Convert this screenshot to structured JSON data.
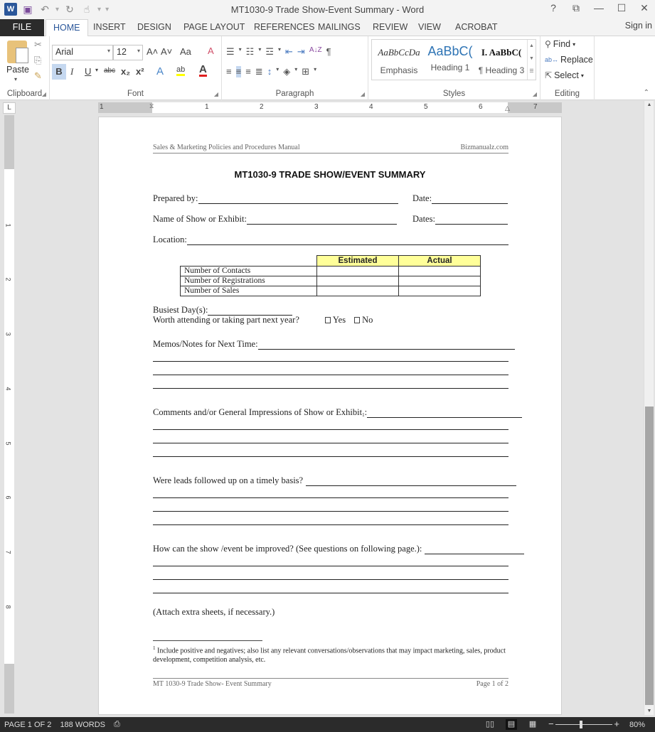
{
  "window": {
    "title": "MT1030-9 Trade Show-Event Summary - Word",
    "controls": {
      "help": "?",
      "ribbon_display": "⧉",
      "minimize": "—",
      "maximize": "☐",
      "close": "✕"
    }
  },
  "quick_access": {
    "app_icon": "W",
    "save_icon": "💾",
    "undo_icon": "↶",
    "redo_icon": "↻",
    "touch_icon": "☝",
    "customize_icon": "▾"
  },
  "tabs": [
    {
      "label": "FILE"
    },
    {
      "label": "HOME",
      "active": true
    },
    {
      "label": "INSERT"
    },
    {
      "label": "DESIGN"
    },
    {
      "label": "PAGE LAYOUT"
    },
    {
      "label": "REFERENCES"
    },
    {
      "label": "MAILINGS"
    },
    {
      "label": "REVIEW"
    },
    {
      "label": "VIEW"
    },
    {
      "label": "ACROBAT"
    }
  ],
  "signin": "Sign in",
  "ribbon": {
    "clipboard": {
      "label": "Clipboard",
      "paste": "Paste",
      "cut_icon": "✂",
      "copy_icon": "⎘",
      "format_painter_icon": "🖌"
    },
    "font": {
      "label": "Font",
      "font_name": "Arial",
      "font_size": "12",
      "grow": "A˄",
      "shrink": "A˅",
      "change_case": "Aa",
      "clear_format": "A",
      "bold": "B",
      "italic": "I",
      "underline": "U",
      "strike": "abc",
      "subscript": "x₂",
      "superscript": "x²",
      "text_effects": "A",
      "highlight": "ab",
      "font_color": "A"
    },
    "paragraph": {
      "label": "Paragraph",
      "bullets": "☰",
      "numbering": "☷",
      "multilevel": "☲",
      "decrease_indent": "⇤",
      "increase_indent": "⇥",
      "sort": "A↓Z",
      "show_marks": "¶",
      "align_left": "≡",
      "align_center": "≡",
      "align_right": "≡",
      "justify": "≣",
      "line_spacing": "↕",
      "shading": "◈",
      "borders": "⊞"
    },
    "styles": {
      "label": "Styles",
      "items": [
        {
          "sample": "AaBbCcDa",
          "name": "Emphasis"
        },
        {
          "sample": "AaBbC(",
          "name": "Heading 1"
        },
        {
          "sample": "I. AaBbC(",
          "name": "¶ Heading 3"
        }
      ]
    },
    "editing": {
      "label": "Editing",
      "find": "Find",
      "replace": "Replace",
      "select": "Select"
    }
  },
  "rulers": {
    "tab_selector": "L",
    "h_numbers": [
      "1",
      "1",
      "2",
      "3",
      "4",
      "5",
      "6",
      "7"
    ],
    "v_numbers": [
      "1",
      "2",
      "3",
      "4",
      "5",
      "6",
      "7",
      "8"
    ]
  },
  "document": {
    "header_left": "Sales & Marketing Policies and Procedures Manual",
    "header_right": "Bizmanualz.com",
    "title": "MT1030-9 TRADE SHOW/EVENT SUMMARY",
    "fields": {
      "prepared_by": "Prepared by:",
      "date": "Date:",
      "show_name": "Name of Show or Exhibit:",
      "dates": "Dates:",
      "location": "Location:"
    },
    "table": {
      "headers": [
        "",
        "Estimated",
        "Actual"
      ],
      "rows": [
        [
          "Number of Contacts",
          "",
          ""
        ],
        [
          "Number of Registrations",
          "",
          ""
        ],
        [
          "Number of Sales",
          "",
          ""
        ]
      ]
    },
    "busiest_days": "Busiest Day(s):",
    "worth_attending": "Worth attending or taking part next year?",
    "yes_label": "Yes",
    "no_label": "No",
    "memos": "Memos/Notes for Next Time:",
    "comments": "Comments and/or General Impressions of Show or Exhibit",
    "comments_footnote_ref": "1",
    "comments_suffix": ":",
    "leads": "Were leads followed up on a timely basis?",
    "improved": "How can the show /event be improved? (See questions on following page.):",
    "attach": "(Attach extra sheets, if necessary.)",
    "footnote_num": "1",
    "footnote_text": "Include positive and negatives; also list any relevant conversations/observations that may impact marketing, sales, product development, competition analysis, etc.",
    "footer_left": "MT 1030-9 Trade Show- Event Summary",
    "footer_right": "Page 1 of 2"
  },
  "status": {
    "page": "PAGE 1 OF 2",
    "words": "188 WORDS",
    "proofing_icon": "📖",
    "read_mode_icon": "📖",
    "print_layout_icon": "▤",
    "web_layout_icon": "🌐",
    "zoom_minus": "−",
    "zoom_plus": "+",
    "zoom_level": "80%"
  },
  "colors": {
    "accent": "#2b579a",
    "table_header": "#ffff99",
    "status_bar": "#2b2b2b"
  }
}
